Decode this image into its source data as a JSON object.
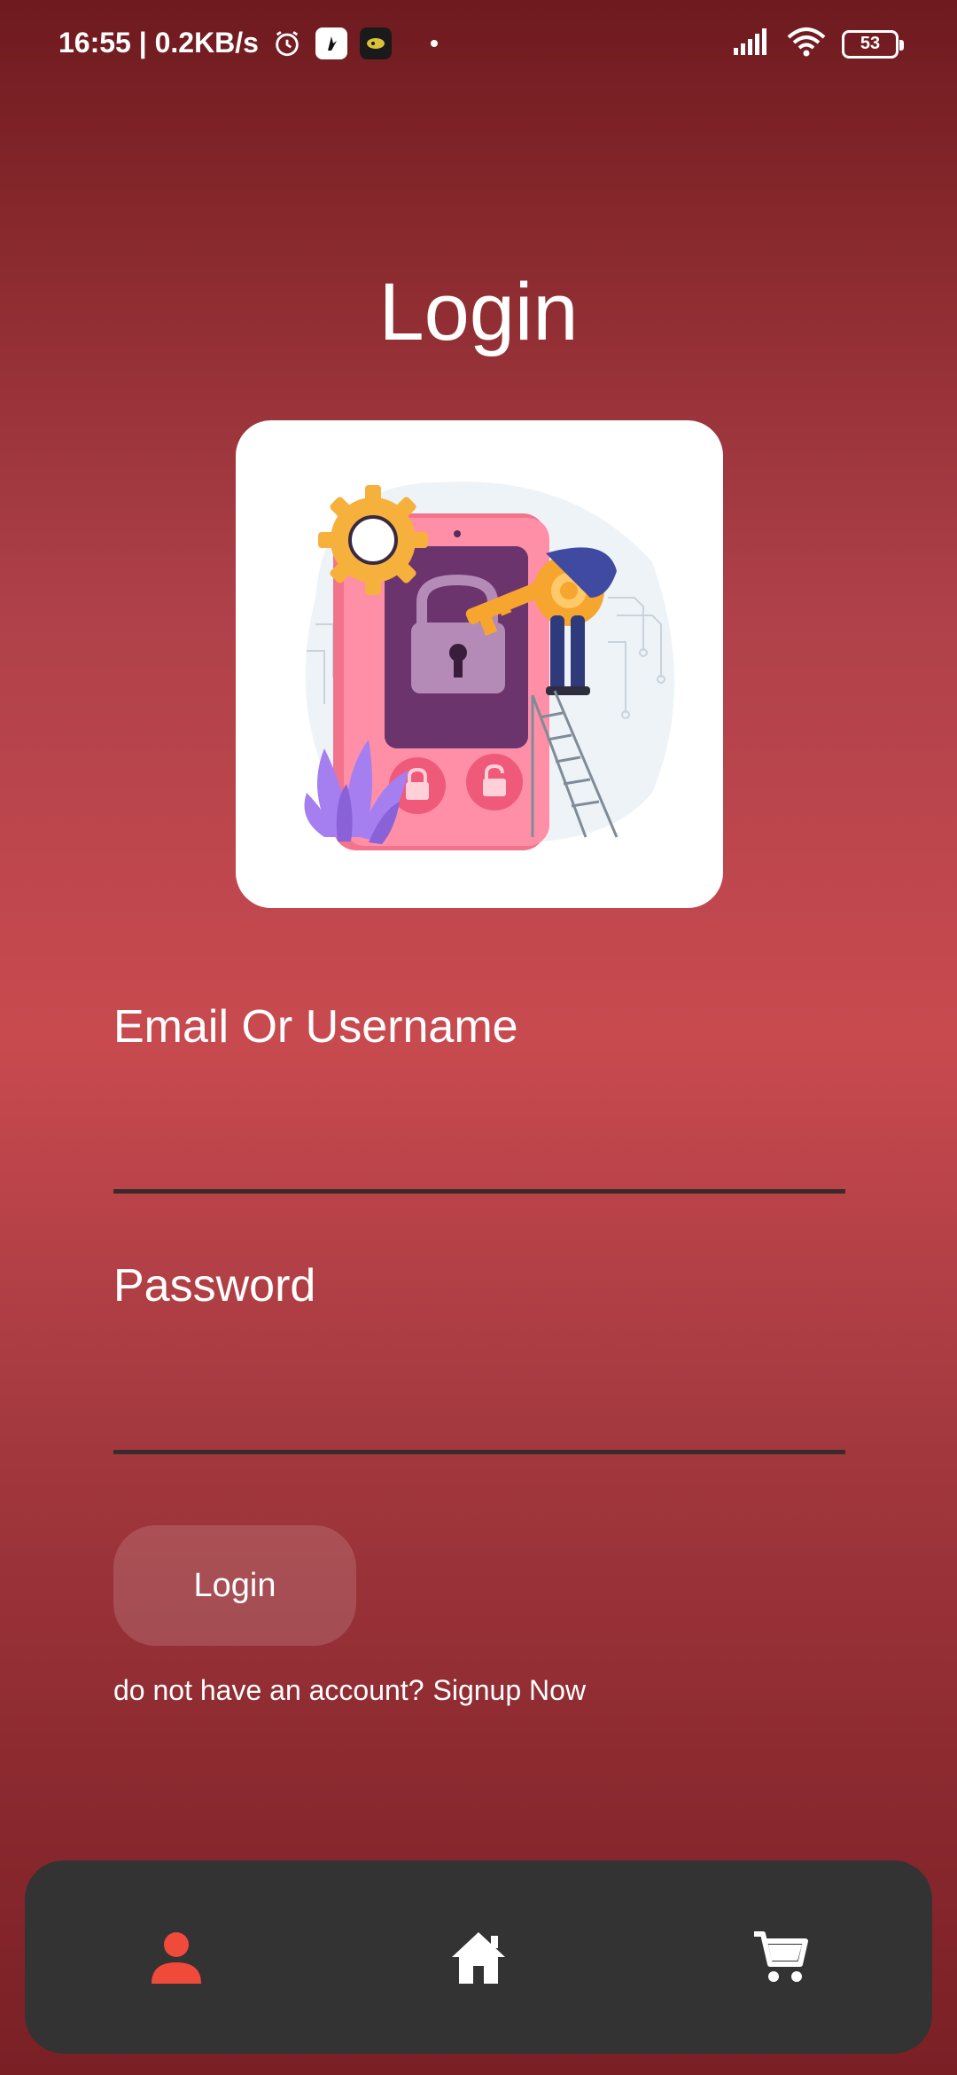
{
  "status_bar": {
    "time_speed": "16:55 | 0.2KB/s",
    "battery": "53",
    "icons": [
      "alarm-icon",
      "app-notification-icon",
      "app-notification-icon-2",
      "signal-icon",
      "wifi-icon",
      "battery-icon"
    ]
  },
  "page": {
    "title": "Login"
  },
  "form": {
    "email_label": "Email Or Username",
    "email_value": "",
    "password_label": "Password",
    "password_value": "",
    "login_button": "Login",
    "signup_prompt": "do not have an account?",
    "signup_link": "Signup Now"
  },
  "bottom_nav": {
    "items": [
      {
        "name": "profile",
        "icon": "person-icon",
        "color": "#f04a3a",
        "active": true
      },
      {
        "name": "home",
        "icon": "home-icon",
        "color": "#ffffff",
        "active": false
      },
      {
        "name": "cart",
        "icon": "cart-icon",
        "color": "#ffffff",
        "active": false
      }
    ]
  },
  "colors": {
    "background_top": "#6e1a1f",
    "background_mid": "#c84a4f",
    "nav_background": "#333333",
    "active_nav": "#f04a3a"
  }
}
